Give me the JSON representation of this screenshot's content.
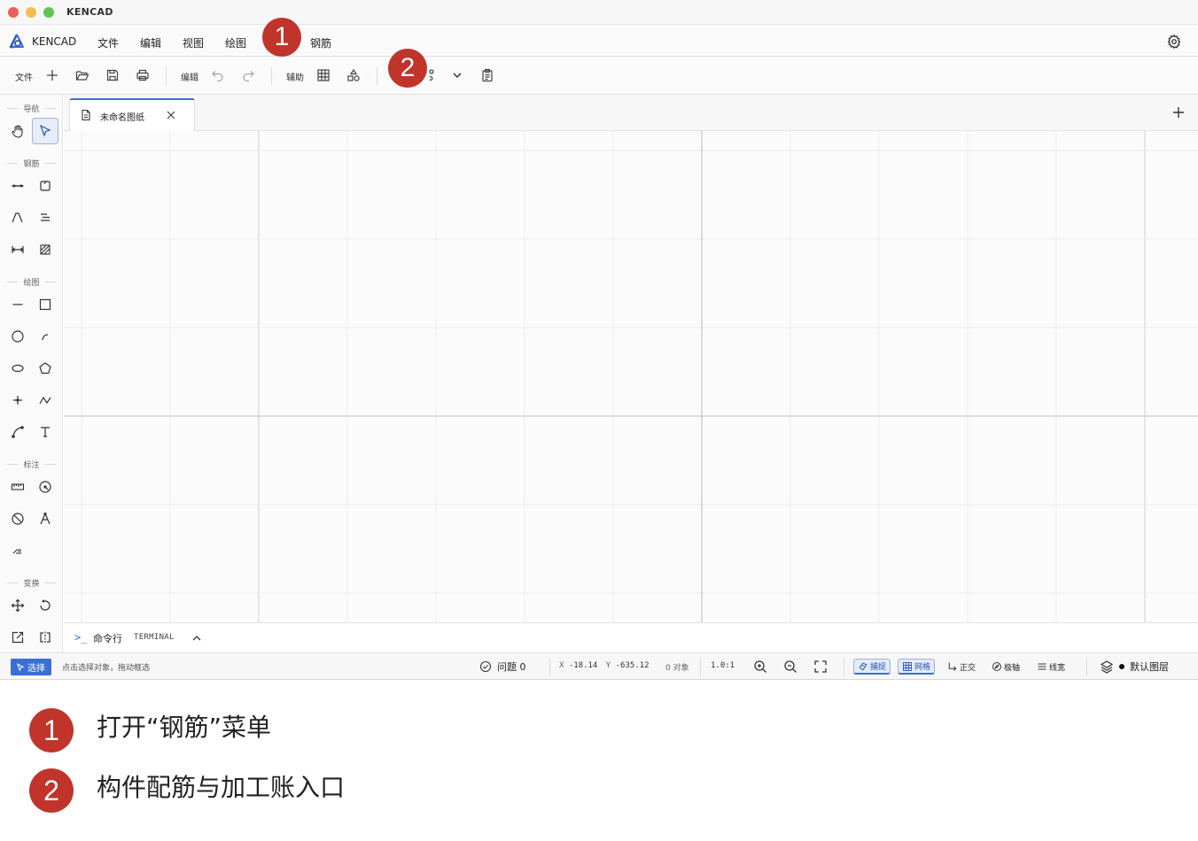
{
  "window": {
    "title": "KENCAD"
  },
  "menubar": {
    "app_name": "KENCAD",
    "items": [
      "文件",
      "编辑",
      "视图",
      "绘图",
      "钢筋"
    ]
  },
  "toolbar": {
    "file_label": "文件",
    "edit_label": "编辑",
    "assist_label": "辅助"
  },
  "leftpanel": {
    "sections": {
      "nav": "导航",
      "rebar": "钢筋",
      "draw": "绘图",
      "dim": "标注",
      "transform": "变换"
    }
  },
  "tabs": [
    {
      "label": "未命名图纸"
    }
  ],
  "cmdline": {
    "prompt": ">_",
    "label": "命令行",
    "sub": "TERMINAL"
  },
  "statusbar": {
    "mode": "选择",
    "hint": "点击选择对象，拖动框选",
    "issues": "问题 0",
    "x_label": "X",
    "x_value": "-18.14",
    "y_label": "Y",
    "y_value": "-635.12",
    "objects": "0 对象",
    "scale": "1.0:1",
    "toggles": {
      "snap": "捕捉",
      "grid": "网格",
      "ortho": "正交",
      "polar": "极轴",
      "lineweight": "线宽"
    },
    "layer": "默认图层"
  },
  "callouts": [
    {
      "number": "1",
      "text": "打开“钢筋”菜单"
    },
    {
      "number": "2",
      "text": "构件配筋与加工账入口"
    }
  ],
  "colors": {
    "accent": "#3b6fd6",
    "callout": "#c0342b",
    "axis_x": "#d9b8c0",
    "axis_y": "#bdbdbd"
  }
}
